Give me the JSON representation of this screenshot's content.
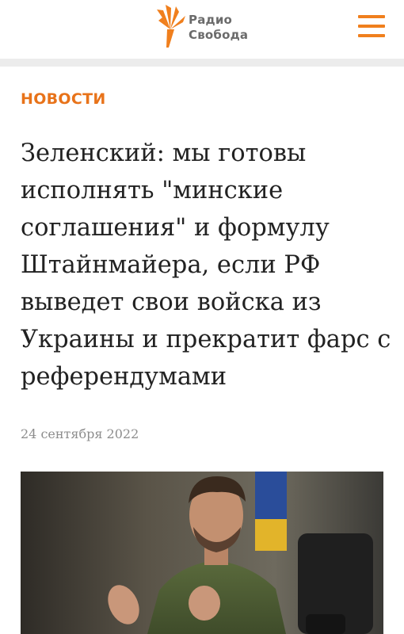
{
  "header": {
    "logo": {
      "line1": "Радио",
      "line2": "Свобода",
      "icon": "torch-icon"
    },
    "menu_icon": "hamburger-menu-icon",
    "accent_color": "#f07f1d"
  },
  "article": {
    "section": "НОВОСТИ",
    "headline": "Зеленский: мы готовы исполнять \"минские соглашения\" и формулу Штайнмайера, если РФ выведет свои войска из Украины и прекратит фарс с референдумами",
    "date": "24 сентября 2022",
    "photo": {
      "description": "photo-of-speaker"
    }
  }
}
